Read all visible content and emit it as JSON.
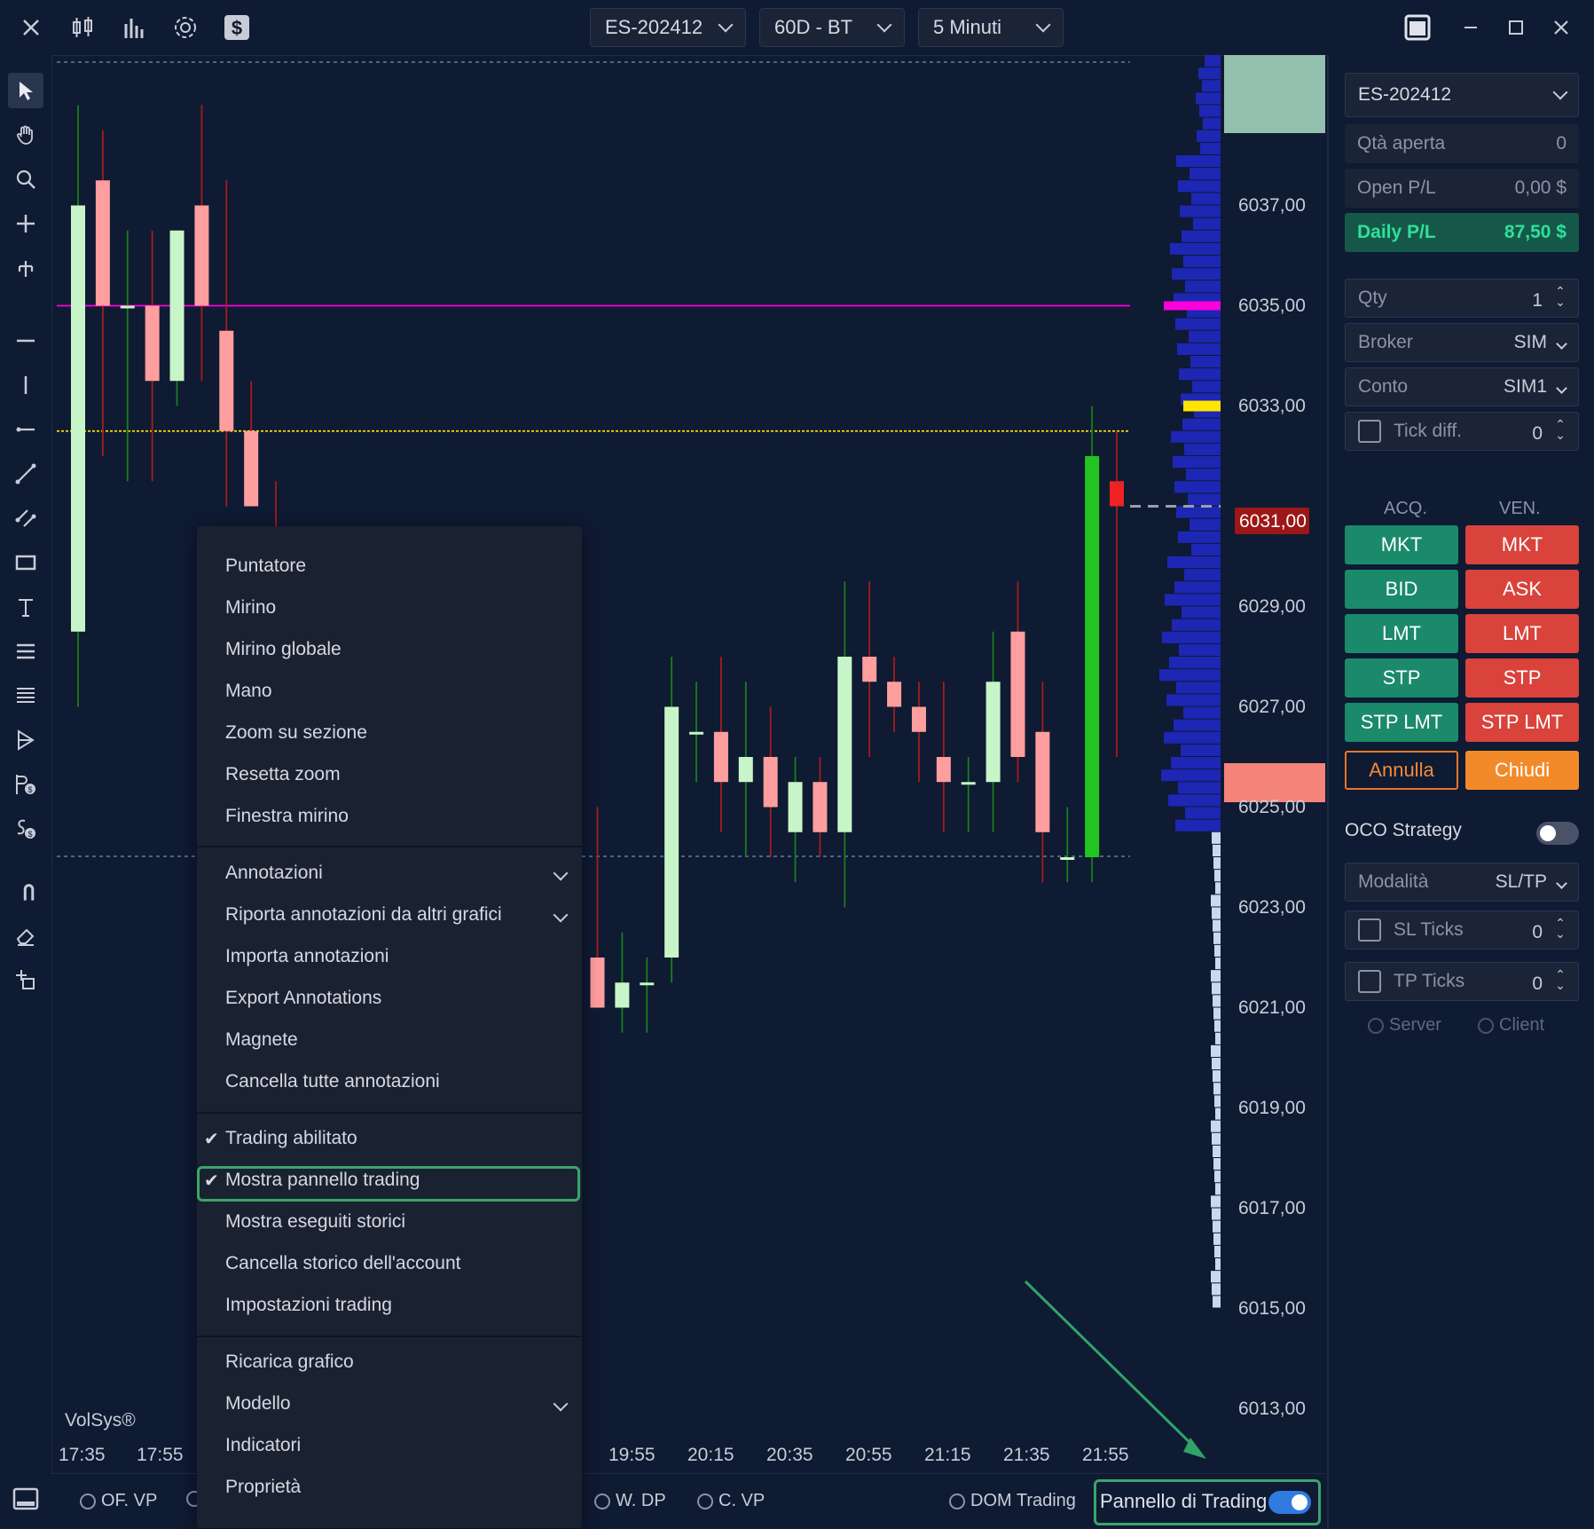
{
  "topbar": {
    "symbol": "ES-202412",
    "range": "60D - BT",
    "timeframe": "5 Minuti"
  },
  "chart": {
    "watermark": "VolSys®",
    "price_ticks": [
      "6037,00",
      "6035,00",
      "6033,00",
      "6031,00",
      "6029,00",
      "6027,00",
      "6025,00",
      "6023,00",
      "6021,00",
      "6019,00",
      "6017,00",
      "6015,00",
      "6013,00"
    ],
    "current_price": "6031,00",
    "time_ticks": [
      "17:35",
      "17:55",
      "19:55",
      "20:15",
      "20:35",
      "20:55",
      "21:15",
      "21:35",
      "21:55"
    ],
    "colors": {
      "up": "#c8f5c8",
      "down": "#ff9e9e",
      "up_last": "#22c422",
      "down_last": "#ee2222",
      "magenta": "#ff00dd",
      "yellow": "#ffe400",
      "profile": "#1d27b4"
    }
  },
  "chart_data": {
    "type": "candlestick",
    "ylim": [
      6012,
      6040
    ],
    "candles": [
      {
        "o": 6028.5,
        "h": 6039.0,
        "l": 6027.0,
        "c": 6037.0
      },
      {
        "o": 6037.5,
        "h": 6038.5,
        "l": 6032.0,
        "c": 6035.0
      },
      {
        "o": 6035.0,
        "h": 6036.5,
        "l": 6031.5,
        "c": 6035.0
      },
      {
        "o": 6035.0,
        "h": 6036.5,
        "l": 6031.5,
        "c": 6033.5
      },
      {
        "o": 6033.5,
        "h": 6036.0,
        "l": 6033.0,
        "c": 6036.5
      },
      {
        "o": 6037.0,
        "h": 6039.0,
        "l": 6033.5,
        "c": 6035.0
      },
      {
        "o": 6034.5,
        "h": 6037.5,
        "l": 6031.0,
        "c": 6032.5
      },
      {
        "o": 6032.5,
        "h": 6033.5,
        "l": 6031.5,
        "c": 6031.0
      },
      {
        "o": 6030.5,
        "h": 6031.5,
        "l": 6024.0,
        "c": 6024.5
      },
      {
        "o": 6024.0,
        "h": 6029.5,
        "l": 6023.0,
        "c": 6025.0
      },
      {
        "o": 6024.5,
        "h": 6029.5,
        "l": 6023.0,
        "c": 6024.5
      },
      {
        "o": 6024.5,
        "h": 6030.0,
        "l": 6023.0,
        "c": 6028.5
      },
      {
        "o": 6029.0,
        "h": 6030.5,
        "l": 6024.5,
        "c": 6025.0
      },
      {
        "o": 6024.5,
        "h": 6027.0,
        "l": 6023.5,
        "c": 6024.0
      },
      {
        "o": 6024.0,
        "h": 6026.5,
        "l": 6023.0,
        "c": 6023.5
      },
      {
        "o": 6023.5,
        "h": 6025.5,
        "l": 6023.0,
        "c": 6022.5
      },
      {
        "o": 6022.0,
        "h": 6026.0,
        "l": 6021.5,
        "c": 6025.0
      },
      {
        "o": 6025.5,
        "h": 6028.0,
        "l": 6021.0,
        "c": 6024.0
      },
      {
        "o": 6024.0,
        "h": 6026.0,
        "l": 6020.5,
        "c": 6022.0
      },
      {
        "o": 6021.5,
        "h": 6025.0,
        "l": 6020.5,
        "c": 6024.5
      },
      {
        "o": 6024.5,
        "h": 6028.5,
        "l": 6022.5,
        "c": 6022.5
      },
      {
        "o": 6022.0,
        "h": 6025.0,
        "l": 6021.5,
        "c": 6021.0
      },
      {
        "o": 6021.0,
        "h": 6022.5,
        "l": 6020.5,
        "c": 6021.5
      },
      {
        "o": 6021.5,
        "h": 6022.0,
        "l": 6020.5,
        "c": 6021.5
      },
      {
        "o": 6022.0,
        "h": 6028.0,
        "l": 6021.5,
        "c": 6027.0
      },
      {
        "o": 6026.5,
        "h": 6027.5,
        "l": 6025.5,
        "c": 6026.5
      },
      {
        "o": 6026.5,
        "h": 6028.0,
        "l": 6024.5,
        "c": 6025.5
      },
      {
        "o": 6025.5,
        "h": 6027.5,
        "l": 6024.0,
        "c": 6026.0
      },
      {
        "o": 6026.0,
        "h": 6027.0,
        "l": 6024.0,
        "c": 6025.0
      },
      {
        "o": 6024.5,
        "h": 6026.0,
        "l": 6023.5,
        "c": 6025.5
      },
      {
        "o": 6025.5,
        "h": 6026.0,
        "l": 6024.0,
        "c": 6024.5
      },
      {
        "o": 6024.5,
        "h": 6029.5,
        "l": 6023.0,
        "c": 6028.0
      },
      {
        "o": 6028.0,
        "h": 6029.5,
        "l": 6026.0,
        "c": 6027.5
      },
      {
        "o": 6027.5,
        "h": 6028.0,
        "l": 6026.5,
        "c": 6027.0
      },
      {
        "o": 6027.0,
        "h": 6027.5,
        "l": 6025.5,
        "c": 6026.5
      },
      {
        "o": 6026.0,
        "h": 6027.5,
        "l": 6024.5,
        "c": 6025.5
      },
      {
        "o": 6025.5,
        "h": 6026.0,
        "l": 6024.5,
        "c": 6025.5
      },
      {
        "o": 6025.5,
        "h": 6028.5,
        "l": 6024.5,
        "c": 6027.5
      },
      {
        "o": 6028.5,
        "h": 6029.5,
        "l": 6025.5,
        "c": 6026.0
      },
      {
        "o": 6026.5,
        "h": 6027.5,
        "l": 6023.5,
        "c": 6024.5
      },
      {
        "o": 6024.0,
        "h": 6025.0,
        "l": 6023.5,
        "c": 6024.0
      },
      {
        "o": 6024.0,
        "h": 6033.0,
        "l": 6023.5,
        "c": 6032.0
      },
      {
        "o": 6031.5,
        "h": 6032.5,
        "l": 6026.0,
        "c": 6031.0
      }
    ],
    "levels": [
      {
        "price": 6035.0,
        "color": "magenta"
      },
      {
        "price": 6032.5,
        "color": "yellow"
      }
    ]
  },
  "menu": {
    "items": [
      {
        "label": "Puntatore"
      },
      {
        "label": "Mirino"
      },
      {
        "label": "Mirino globale"
      },
      {
        "label": "Mano"
      },
      {
        "label": "Zoom su sezione"
      },
      {
        "label": "Resetta zoom"
      },
      {
        "label": "Finestra mirino"
      },
      {
        "label": "Annotazioni"
      },
      {
        "label": "Riporta annotazioni da altri grafici"
      },
      {
        "label": "Importa annotazioni"
      },
      {
        "label": "Export Annotations"
      },
      {
        "label": "Magnete"
      },
      {
        "label": "Cancella tutte annotazioni"
      },
      {
        "label": "Trading abilitato"
      },
      {
        "label": "Mostra pannello trading"
      },
      {
        "label": "Mostra eseguiti storici"
      },
      {
        "label": "Cancella storico dell'account"
      },
      {
        "label": "Impostazioni trading"
      },
      {
        "label": "Ricarica grafico"
      },
      {
        "label": "Modello"
      },
      {
        "label": "Indicatori"
      },
      {
        "label": "Proprietà"
      }
    ]
  },
  "bottombar": {
    "of_vp": "OF. VP",
    "w_dp": "W. DP",
    "c_vp": "C. VP",
    "dom_trading": "DOM Trading",
    "pannello": "Pannello di Trading"
  },
  "panel": {
    "symbol": "ES-202412",
    "qta_aperta_label": "Qtà aperta",
    "qta_aperta_value": "0",
    "open_pl_label": "Open P/L",
    "open_pl_value": "0,00 $",
    "daily_pl_label": "Daily P/L",
    "daily_pl_value": "87,50 $",
    "qty_label": "Qty",
    "qty_value": "1",
    "broker_label": "Broker",
    "broker_value": "SIM",
    "conto_label": "Conto",
    "conto_value": "SIM1",
    "tick_diff_label": "Tick diff.",
    "tick_diff_value": "0",
    "acq": "ACQ.",
    "ven": "VEN.",
    "buy_buttons": [
      "MKT",
      "BID",
      "LMT",
      "STP",
      "STP LMT"
    ],
    "sell_buttons": [
      "MKT",
      "ASK",
      "LMT",
      "STP",
      "STP LMT"
    ],
    "annulla": "Annulla",
    "chiudi": "Chiudi",
    "oco_label": "OCO Strategy",
    "modalita_label": "Modalità",
    "modalita_value": "SL/TP",
    "sl_label": "SL Ticks",
    "sl_value": "0",
    "tp_label": "TP Ticks",
    "tp_value": "0",
    "server": "Server",
    "client": "Client"
  }
}
